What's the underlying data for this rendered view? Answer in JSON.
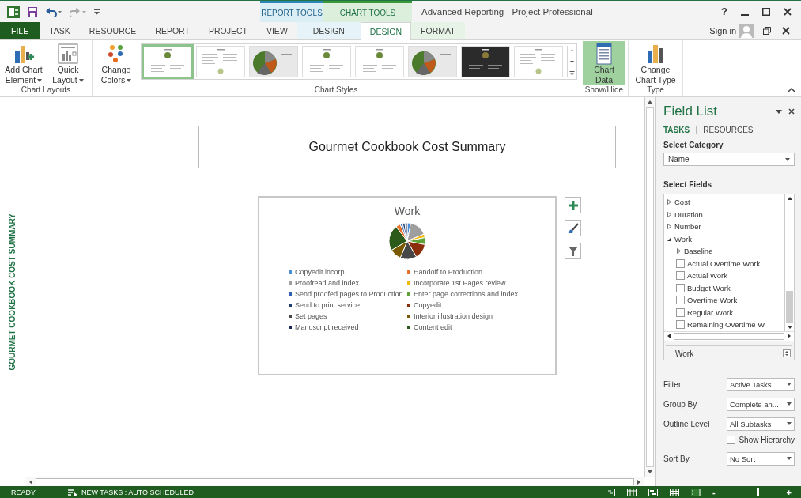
{
  "title_bar": {
    "title": "Advanced Reporting - Project Professional",
    "help": "?",
    "sign_in": "Sign in"
  },
  "context_groups": [
    {
      "label": "REPORT TOOLS",
      "kind": "report"
    },
    {
      "label": "CHART TOOLS",
      "kind": "chart"
    }
  ],
  "tabs": [
    {
      "label": "FILE",
      "kind": "file",
      "selected": false
    },
    {
      "label": "TASK",
      "kind": "plain",
      "selected": false
    },
    {
      "label": "RESOURCE",
      "kind": "plain",
      "selected": false
    },
    {
      "label": "REPORT",
      "kind": "plain",
      "selected": false
    },
    {
      "label": "PROJECT",
      "kind": "plain",
      "selected": false
    },
    {
      "label": "VIEW",
      "kind": "plain",
      "selected": false
    },
    {
      "label": "DESIGN",
      "kind": "report",
      "selected": false
    },
    {
      "label": "DESIGN",
      "kind": "chart",
      "selected": true
    },
    {
      "label": "FORMAT",
      "kind": "chart",
      "selected": false
    }
  ],
  "ribbon": {
    "chart_layouts": {
      "label": "Chart Layouts",
      "buttons": [
        {
          "label": "Add Chart Element",
          "kind": "add-element",
          "dropdown": true
        },
        {
          "label": "Quick Layout",
          "kind": "quick-layout",
          "dropdown": true
        }
      ]
    },
    "chart_styles": {
      "label": "Chart Styles",
      "colors_button": {
        "label": "Change Colors",
        "dropdown": true
      },
      "styles": [
        {
          "kind": "small-pie",
          "selected": true
        },
        {
          "kind": "list",
          "selected": false
        },
        {
          "kind": "big-pie",
          "selected": false
        },
        {
          "kind": "small-pie",
          "selected": false
        },
        {
          "kind": "small-pie",
          "selected": false
        },
        {
          "kind": "big-pie",
          "selected": false
        },
        {
          "kind": "dark",
          "selected": false
        },
        {
          "kind": "list",
          "selected": false
        }
      ]
    },
    "show_hide": {
      "label": "Show/Hide",
      "button": {
        "label": "Chart Data",
        "selected": true
      }
    },
    "type": {
      "label": "Type",
      "button": {
        "label": "Change Chart Type",
        "selected": false
      }
    }
  },
  "report": {
    "side_label": "GOURMET COOKBOOK COST SUMMARY",
    "title": "Gourmet Cookbook Cost Summary",
    "chart": {
      "title": "Work",
      "legend": [
        {
          "label": "Copyedit incorp",
          "color": "#4a8fd6"
        },
        {
          "label": "Handoff to Production",
          "color": "#e8702a"
        },
        {
          "label": "Proofread and index",
          "color": "#9e9e9e"
        },
        {
          "label": "Incorporate 1st Pages review",
          "color": "#f5b800"
        },
        {
          "label": "Send proofed pages to Production",
          "color": "#2e5fb0"
        },
        {
          "label": "Enter page corrections and index",
          "color": "#5ea33a"
        },
        {
          "label": "Send to print service",
          "color": "#1f3f73"
        },
        {
          "label": "Copyedit",
          "color": "#8b2e0b"
        },
        {
          "label": "Set pages",
          "color": "#474747"
        },
        {
          "label": "Interior illustration design",
          "color": "#7a5a00"
        },
        {
          "label": "Manuscript received",
          "color": "#1c2a5a"
        },
        {
          "label": "Content edit",
          "color": "#2b5a1a"
        }
      ]
    }
  },
  "field_list": {
    "title": "Field List",
    "tabs": [
      {
        "label": "TASKS",
        "selected": true
      },
      {
        "label": "RESOURCES",
        "selected": false
      }
    ],
    "category_label": "Select Category",
    "category": "Name",
    "fields_label": "Select Fields",
    "tree": [
      {
        "label": "Cost",
        "kind": "group",
        "expanded": false
      },
      {
        "label": "Duration",
        "kind": "group",
        "expanded": false
      },
      {
        "label": "Number",
        "kind": "group",
        "expanded": false
      },
      {
        "label": "Work",
        "kind": "group",
        "expanded": true,
        "children": [
          {
            "label": "Baseline",
            "kind": "group",
            "expanded": false
          },
          {
            "label": "Actual Overtime Work",
            "kind": "field",
            "checked": false
          },
          {
            "label": "Actual Work",
            "kind": "field",
            "checked": false
          },
          {
            "label": "Budget Work",
            "kind": "field",
            "checked": false
          },
          {
            "label": "Overtime Work",
            "kind": "field",
            "checked": false
          },
          {
            "label": "Regular Work",
            "kind": "field",
            "checked": false
          },
          {
            "label": "Remaining Overtime W",
            "kind": "field",
            "checked": false
          }
        ]
      }
    ],
    "selected_field": "Work",
    "options": [
      {
        "label": "Filter",
        "kind": "dropdown",
        "value": "Active Tasks"
      },
      {
        "label": "Group By",
        "kind": "dropdown",
        "value": "Complete an..."
      },
      {
        "label": "Outline Level",
        "kind": "dropdown",
        "value": "All Subtasks"
      },
      {
        "label": "Show Hierarchy",
        "kind": "checkbox",
        "checked": false
      },
      {
        "label": "Sort By",
        "kind": "dropdown",
        "value": "No Sort"
      }
    ]
  },
  "status_bar": {
    "mode": "READY",
    "new_tasks": "NEW TASKS : AUTO SCHEDULED",
    "zoom": {
      "minus": "-",
      "plus": "+",
      "level": 0.6
    }
  }
}
